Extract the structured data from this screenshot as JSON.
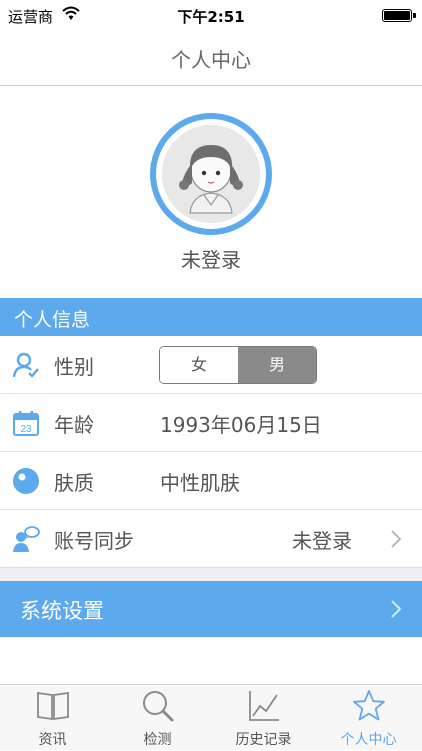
{
  "status_bar": {
    "carrier": "运营商",
    "time": "下午2:51"
  },
  "nav": {
    "title": "个人中心"
  },
  "profile": {
    "login_status": "未登录"
  },
  "section": {
    "title": "个人信息"
  },
  "rows": {
    "gender": {
      "label": "性别",
      "options": [
        "女",
        "男"
      ],
      "selected": "男"
    },
    "age": {
      "label": "年龄",
      "value": "1993年06月15日",
      "calendar_day": "23"
    },
    "skin": {
      "label": "肤质",
      "value": "中性肌肤"
    },
    "sync": {
      "label": "账号同步",
      "value": "未登录"
    }
  },
  "settings": {
    "label": "系统设置"
  },
  "tabs": [
    {
      "label": "资讯",
      "icon": "book-icon"
    },
    {
      "label": "检测",
      "icon": "search-icon"
    },
    {
      "label": "历史记录",
      "icon": "chart-icon"
    },
    {
      "label": "个人中心",
      "icon": "star-icon"
    }
  ],
  "colors": {
    "accent": "#5ca9ee",
    "segment_selected": "#8a8a8a"
  }
}
